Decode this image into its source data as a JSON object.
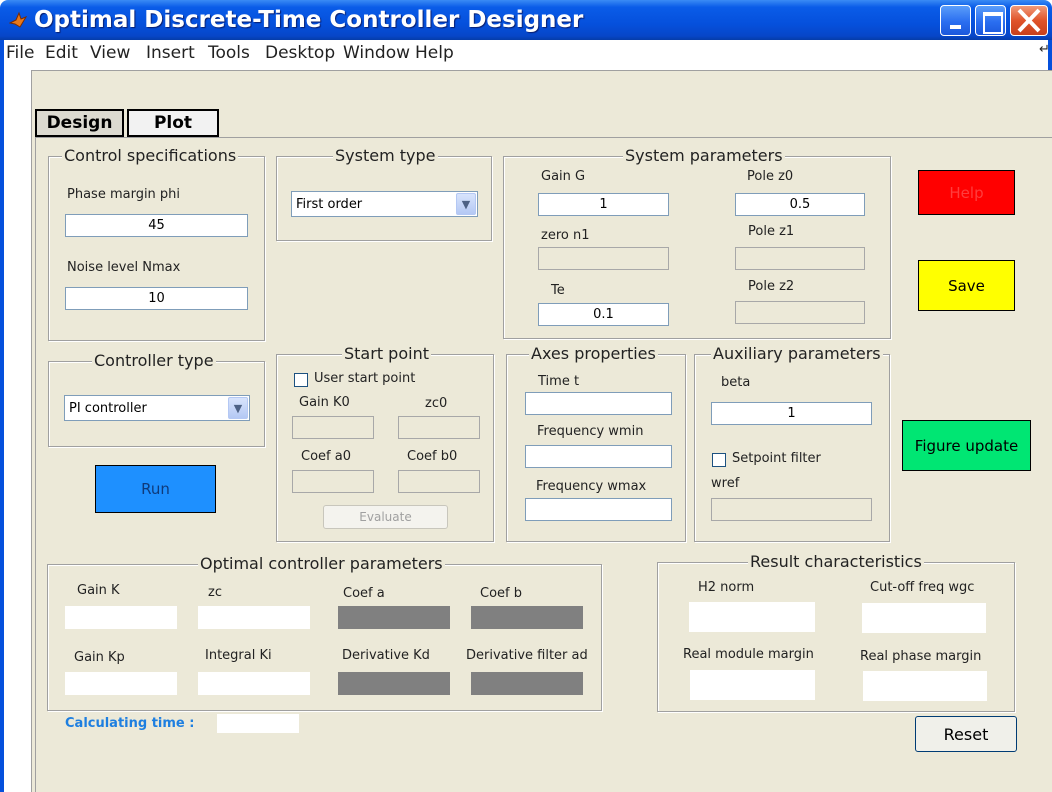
{
  "window": {
    "title": "Optimal Discrete-Time Controller Designer"
  },
  "menu": [
    "File",
    "Edit",
    "View",
    "Insert",
    "Tools",
    "Desktop",
    "Window",
    "Help"
  ],
  "tabs": {
    "design": "Design",
    "plot": "Plot"
  },
  "control_specs": {
    "title": "Control specifications",
    "phase_margin_label": "Phase margin phi",
    "phase_margin_value": "45",
    "noise_label": "Noise level Nmax",
    "noise_value": "10"
  },
  "system_type": {
    "title": "System type",
    "selected": "First order"
  },
  "system_params": {
    "title": "System parameters",
    "gain_label": "Gain G",
    "gain_value": "1",
    "pole_z0_label": "Pole z0",
    "pole_z0_value": "0.5",
    "zero_n1_label": "zero n1",
    "pole_z1_label": "Pole z1",
    "te_label": "Te",
    "te_value": "0.1",
    "pole_z2_label": "Pole z2"
  },
  "controller_type": {
    "title": "Controller type",
    "selected": "PI controller"
  },
  "start_point": {
    "title": "Start point",
    "user_start_label": "User start point",
    "gain_k0_label": "Gain K0",
    "zc0_label": "zc0",
    "coef_a0_label": "Coef a0",
    "coef_b0_label": "Coef b0",
    "evaluate_label": "Evaluate"
  },
  "axes_props": {
    "title": "Axes properties",
    "time_label": "Time t",
    "wmin_label": "Frequency wmin",
    "wmax_label": "Frequency wmax"
  },
  "aux_params": {
    "title": "Auxiliary parameters",
    "beta_label": "beta",
    "beta_value": "1",
    "setpoint_label": "Setpoint filter",
    "wref_label": "wref"
  },
  "buttons": {
    "help": "Help",
    "save": "Save",
    "figure_update": "Figure update",
    "run": "Run",
    "reset": "Reset"
  },
  "optimal_params": {
    "title": "Optimal controller parameters",
    "gain_k_label": "Gain K",
    "zc_label": "zc",
    "coef_a_label": "Coef a",
    "coef_b_label": "Coef b",
    "gain_kp_label": "Gain Kp",
    "integral_ki_label": "Integral Ki",
    "derivative_kd_label": "Derivative Kd",
    "derivative_filter_label": "Derivative filter ad"
  },
  "results": {
    "title": "Result characteristics",
    "h2_label": "H2 norm",
    "cutoff_label": "Cut-off freq wgc",
    "module_margin_label": "Real module margin",
    "phase_margin_label": "Real phase margin"
  },
  "calculating": {
    "label": "Calculating time :"
  },
  "colors": {
    "help_button": "#ff0000",
    "save_button": "#ffff00",
    "figure_update_button": "#00e673",
    "run_button": "#1e90ff",
    "calculating_label": "#1e7fe0"
  }
}
